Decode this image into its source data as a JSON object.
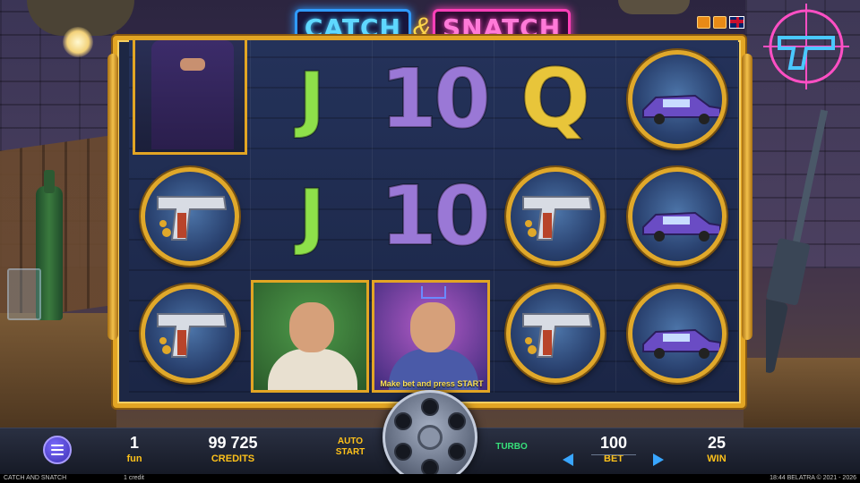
{
  "title": {
    "part1": "CATCH",
    "amp": "&",
    "part2": "SNATCH"
  },
  "reels": [
    {
      "symbols": [
        "boss-seat",
        "pistol",
        "pistol"
      ]
    },
    {
      "symbols": [
        "J",
        "J",
        "gangster-green"
      ]
    },
    {
      "symbols": [
        "10",
        "10",
        "gangster-boss"
      ]
    },
    {
      "symbols": [
        "Q",
        "pistol",
        "pistol"
      ]
    },
    {
      "symbols": [
        "car",
        "car",
        "car"
      ]
    }
  ],
  "reel_text": {
    "r1_top": "J",
    "r1_mid": "J",
    "r2_top": "10",
    "r2_mid": "10",
    "r3_top": "Q"
  },
  "hint": "Make bet and press START",
  "controls": {
    "fun_value": "1",
    "fun_label": "fun",
    "credits_value": "99 725",
    "credits_label": "CREDITS",
    "auto_line1": "AUTO",
    "auto_line2": "START",
    "turbo_label": "TURBO",
    "bet_value": "100",
    "bet_label": "BET",
    "win_value": "25",
    "win_label": "WIN"
  },
  "status": {
    "game_name": "CATCH AND SNATCH",
    "credit_unit": "1 credit",
    "right_text": "18:44   BELATRA © 2021 - 2026"
  },
  "icons": [
    "menu-icon",
    "spin-revolver-icon",
    "arrow-left-icon",
    "arrow-right-icon",
    "flag-uk-icon",
    "neon-gun-icon"
  ],
  "colors": {
    "frame_gold": "#e2a524",
    "label_yellow": "#ffc21a",
    "turbo_green": "#37e07a",
    "arrow_blue": "#39a6ff"
  }
}
